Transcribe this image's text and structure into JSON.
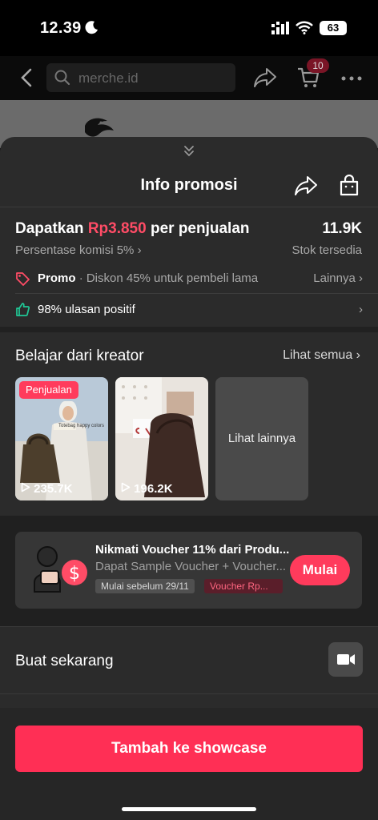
{
  "status": {
    "time": "12.39",
    "battery": "63"
  },
  "appbar": {
    "search_placeholder": "merche.id",
    "cart_count": "10"
  },
  "sheet": {
    "title": "Info promosi",
    "earn_prefix": "Dapatkan",
    "earn_amount": "Rp3.850",
    "earn_suffix": "per penjualan",
    "stock_value": "11.9K",
    "stock_label": "Stok tersedia",
    "commission": "Persentase komisi 5% ›",
    "promo_label": "Promo",
    "promo_text": "· Diskon 45% untuk pembeli lama",
    "promo_more": "Lainnya ›",
    "review_text": "98% ulasan positif",
    "review_more": "›"
  },
  "creators": {
    "title": "Belajar dari kreator",
    "see_all": "Lihat semua ›",
    "cards": [
      {
        "badge": "Penjualan",
        "views": "235.7K",
        "caption": "Totebag happy colors"
      },
      {
        "views": "196.2K"
      }
    ],
    "more_label": "Lihat lainnya"
  },
  "voucher": {
    "title": "Nikmati Voucher 11% dari Produ...",
    "subtitle": "Dapat Sample Voucher + Voucher...",
    "tag_deadline": "Mulai sebelum 29/11",
    "tag_voucher": "Voucher Rp...",
    "button": "Mulai"
  },
  "create": {
    "label": "Buat sekarang"
  },
  "cta": {
    "label": "Tambah ke showcase"
  },
  "colors": {
    "accent": "#ff2f55",
    "sheet_bg": "#2b2b2b",
    "positive": "#20c997"
  }
}
